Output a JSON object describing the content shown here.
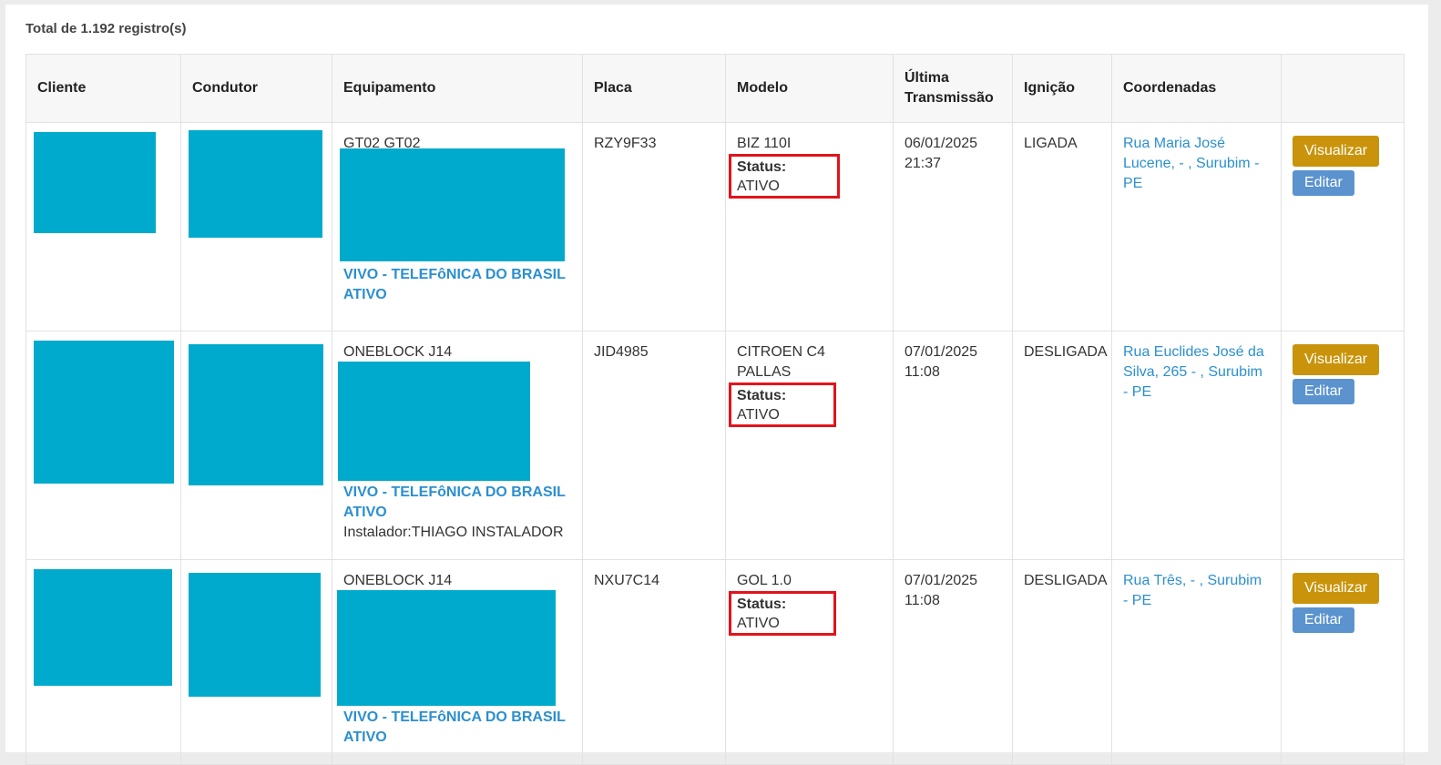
{
  "summary": {
    "total_text": "Total de 1.192 registro(s)"
  },
  "table": {
    "headers": {
      "cliente": "Cliente",
      "condutor": "Condutor",
      "equipamento": "Equipamento",
      "placa": "Placa",
      "modelo": "Modelo",
      "ultima_line1": "Última",
      "ultima_line2": "Transmissão",
      "ignicao": "Ignição",
      "coordenadas": "Coordenadas",
      "acoes": ""
    },
    "rows": [
      {
        "equipamento": "GT02 GT02",
        "carrier": "VIVO - TELEFôNICA DO BRASIL",
        "carrier_status": "ATIVO",
        "instalador": "",
        "placa": "RZY9F33",
        "modelo": "BIZ 110I",
        "status_label": "Status:",
        "status_value": "ATIVO",
        "data": "06/01/2025",
        "hora": "21:37",
        "ignicao": "LIGADA",
        "endereco": "Rua Maria José Lucene, - , Surubim - PE",
        "btn_view": "Visualizar",
        "btn_edit": "Editar"
      },
      {
        "equipamento": "ONEBLOCK J14",
        "carrier": "VIVO - TELEFôNICA DO BRASIL",
        "carrier_status": "ATIVO",
        "instalador": "Instalador:THIAGO INSTALADOR",
        "placa": "JID4985",
        "modelo": "CITROEN C4 PALLAS",
        "status_label": "Status:",
        "status_value": "ATIVO",
        "data": "07/01/2025",
        "hora": "11:08",
        "ignicao": "DESLIGADA",
        "endereco": "Rua Euclides José da Silva, 265 - , Surubim - PE",
        "btn_view": "Visualizar",
        "btn_edit": "Editar"
      },
      {
        "equipamento": "ONEBLOCK J14",
        "carrier": "VIVO - TELEFôNICA DO BRASIL",
        "carrier_status": "ATIVO",
        "instalador": "",
        "placa": "NXU7C14",
        "modelo": "GOL 1.0",
        "status_label": "Status:",
        "status_value": "ATIVO",
        "data": "07/01/2025",
        "hora": "11:08",
        "ignicao": "DESLIGADA",
        "endereco": "Rua Três, - , Surubim - PE",
        "btn_view": "Visualizar",
        "btn_edit": "Editar"
      }
    ]
  },
  "colors": {
    "redaction": "#00aacc",
    "link": "#2b8fd0",
    "view_button": "#c9940b",
    "edit_button": "#5b93cf",
    "highlight_box": "#e3131b"
  }
}
